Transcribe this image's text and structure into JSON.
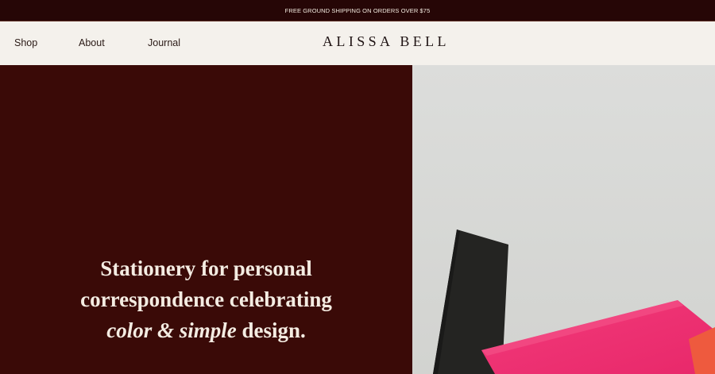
{
  "announcement": {
    "text": "FREE GROUND SHIPPING ON ORDERS OVER $75"
  },
  "nav": {
    "items": [
      {
        "label": "Shop"
      },
      {
        "label": "About"
      },
      {
        "label": "Journal"
      }
    ]
  },
  "brand": {
    "logo": "ALISSA BELL"
  },
  "hero": {
    "line1": "Stationery for personal",
    "line2": "correspondence celebrating",
    "line3_italic_1": "color",
    "line3_amp": "&",
    "line3_italic_2": "simple",
    "line3_end": "design.",
    "image": {
      "icon": "stationery-envelopes-photo"
    }
  },
  "colors": {
    "announcement_bg": "#260606",
    "header_bg": "#f4f1ec",
    "hero_bg": "#3a0a07",
    "hero_text": "#f4ece2",
    "photo_bg": "#d9dad7",
    "envelope_pink": "#ef2f74",
    "card_black": "#242422"
  }
}
